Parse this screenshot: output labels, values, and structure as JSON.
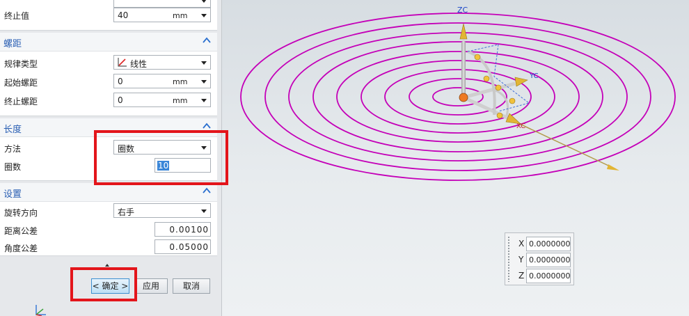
{
  "dialog": {
    "top_partial": {
      "end_value_label": "终止值",
      "end_value": "40",
      "end_value_unit": "mm"
    },
    "pitch": {
      "title": "螺距",
      "law_type_label": "规律类型",
      "law_type_value": "线性",
      "start_pitch_label": "起始螺距",
      "start_pitch_value": "0",
      "start_pitch_unit": "mm",
      "end_pitch_label": "终止螺距",
      "end_pitch_value": "0",
      "end_pitch_unit": "mm"
    },
    "length": {
      "title": "长度",
      "method_label": "方法",
      "method_value": "圈数",
      "turns_label": "圈数",
      "turns_value": "10"
    },
    "settings": {
      "title": "设置",
      "rotation_label": "旋转方向",
      "rotation_value": "右手",
      "distance_tol_label": "距离公差",
      "distance_tol_value": "0.00100",
      "angle_tol_label": "角度公差",
      "angle_tol_value": "0.05000"
    },
    "buttons": {
      "ok": "< 确定 >",
      "apply": "应用",
      "cancel": "取消"
    }
  },
  "viewport": {
    "axis_labels": {
      "z": "ZC",
      "y": "YC",
      "x": "XC"
    },
    "spiral_color": "#c400b8",
    "coordinates": {
      "x_label": "X",
      "x_value": "0.0000000",
      "y_label": "Y",
      "y_value": "0.0000000",
      "z_label": "Z",
      "z_value": "0.0000000"
    }
  },
  "colors": {
    "highlight": "#e3151b",
    "accent": "#2a5fb3"
  }
}
